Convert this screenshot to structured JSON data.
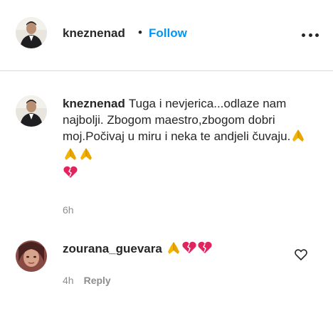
{
  "header": {
    "username": "kneznenad",
    "separator": "•",
    "follow_label": "Follow",
    "more_icon": "more-horizontal-icon"
  },
  "caption": {
    "username": "kneznenad",
    "text": "Tuga i nevjerica...odlaze nam najbolji. Zbogom maestro,zbogom dobri moj.Počivaj u miru i neka te andjeli čuvaju.",
    "emojis": [
      "folded-hands",
      "folded-hands",
      "folded-hands",
      "broken-heart"
    ],
    "time": "6h"
  },
  "comment": {
    "username": "zourana_guevara",
    "emojis": [
      "folded-hands",
      "broken-heart",
      "broken-heart"
    ],
    "time": "4h",
    "reply_label": "Reply"
  },
  "colors": {
    "accent": "#0095f6",
    "text": "#262626",
    "muted": "#8e8e8e",
    "divider": "#dbdbdb",
    "heart": "#e0245e",
    "hands": "#f4b400"
  }
}
